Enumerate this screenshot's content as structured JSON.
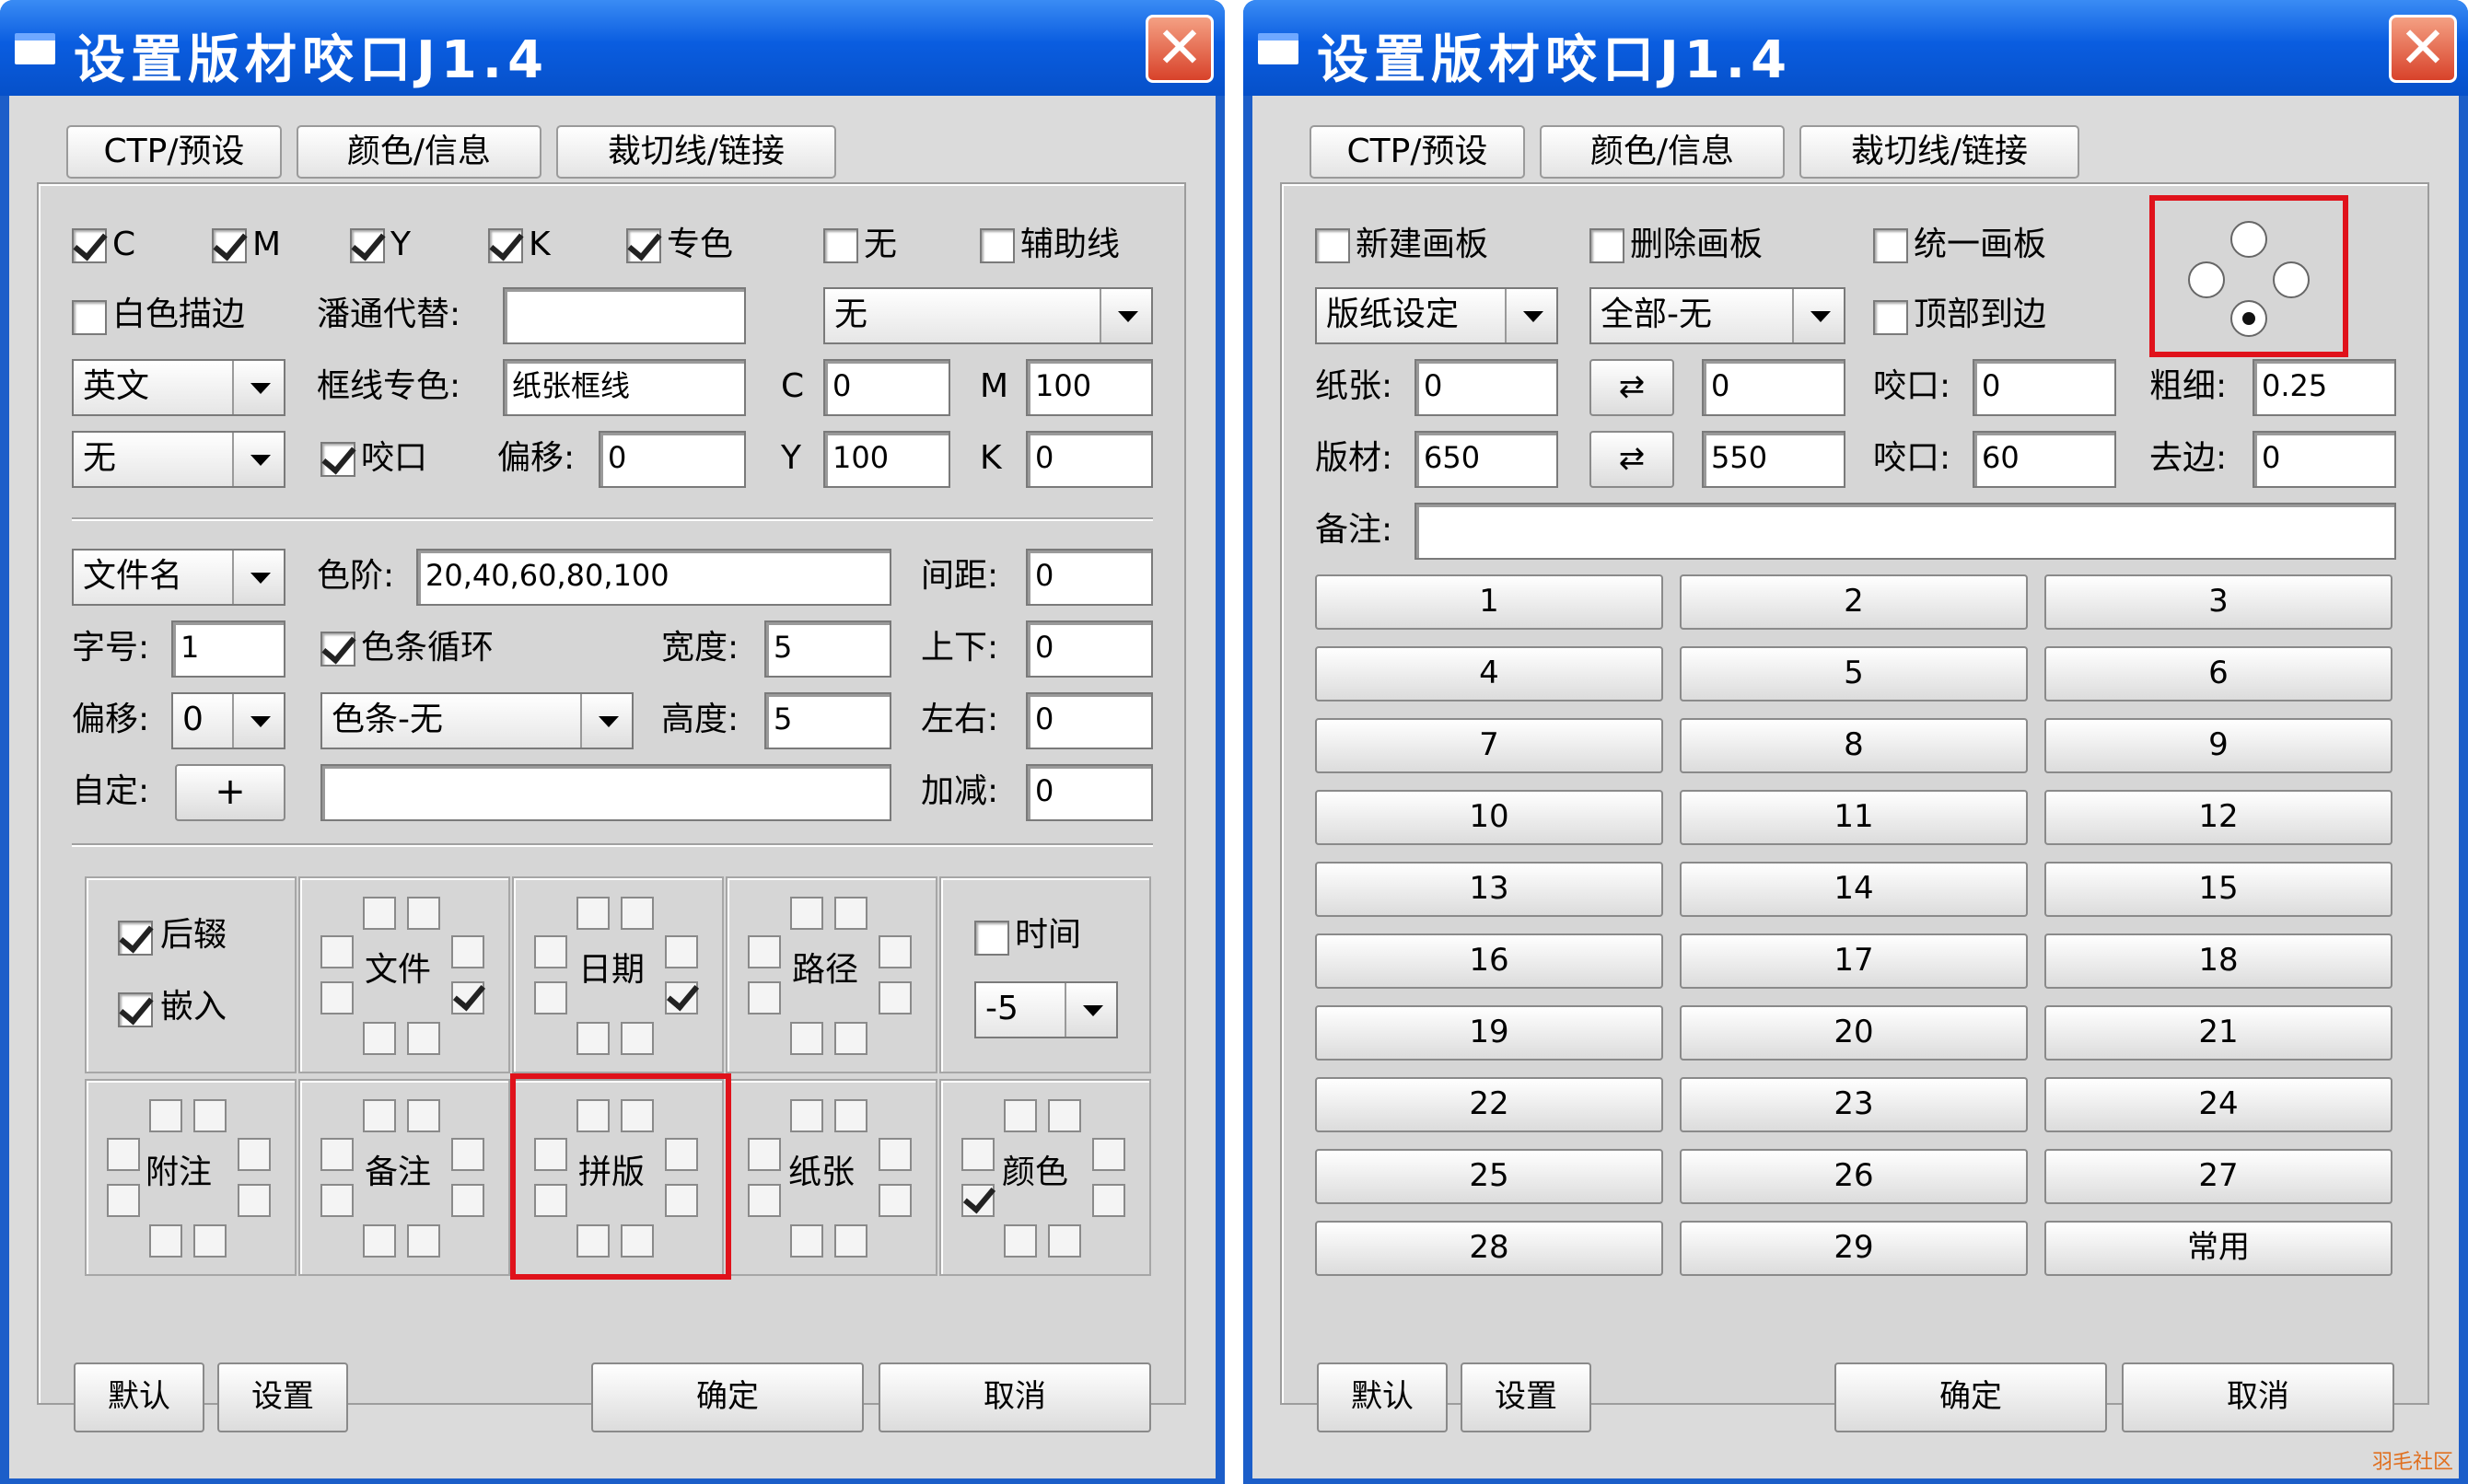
{
  "windows": [
    {
      "title": "设置版材咬口J1.4",
      "close": "✕",
      "tabs": [
        "CTP/预设",
        "颜色/信息",
        "裁切线/链接"
      ],
      "color_checks": [
        {
          "label": "C",
          "checked": true
        },
        {
          "label": "M",
          "checked": true
        },
        {
          "label": "Y",
          "checked": true
        },
        {
          "label": "K",
          "checked": true
        },
        {
          "label": "专色",
          "checked": true
        },
        {
          "label": "无",
          "checked": false
        },
        {
          "label": "辅助线",
          "checked": false
        }
      ],
      "white_outline": "白色描边",
      "pantone_sub_label": "潘通代替:",
      "pantone_sub_value": "",
      "select_none": "无",
      "lang_select": "英文",
      "frame_spot_label": "框线专色:",
      "frame_spot_value": "纸张框线",
      "c_label": "C",
      "c_value": "0",
      "m_label": "M",
      "m_value": "100",
      "none_select": "无",
      "bite_label": "咬口",
      "offset_label": "偏移:",
      "offset_value": "0",
      "y_label": "Y",
      "y_value": "100",
      "k_label": "K",
      "k_value": "0",
      "filename_select": "文件名",
      "steps_label": "色阶:",
      "steps_value": "20,40,60,80,100",
      "spacing_label": "间距:",
      "spacing_value": "0",
      "fontsize_label": "字号:",
      "fontsize_value": "1",
      "colorbar_loop": "色条循环",
      "width_label": "宽度:",
      "width_value": "5",
      "updown_label": "上下:",
      "updown_value": "0",
      "offset2_label": "偏移:",
      "offset2_value": "0",
      "colorbar_select": "色条-无",
      "height_label": "高度:",
      "height_value": "5",
      "leftright_label": "左右:",
      "leftright_value": "0",
      "custom_label": "自定:",
      "custom_btn": "+",
      "custom_value": "",
      "plusminus_label": "加减:",
      "plusminus_value": "0",
      "suffix": "后辍",
      "embed": "嵌入",
      "cells_row1": [
        "文件",
        "日期",
        "路径"
      ],
      "time_label": "时间",
      "time_value": "-5",
      "cells_row2": [
        "附注",
        "备注",
        "拼版",
        "纸张",
        "颜色"
      ],
      "btn_default": "默认",
      "btn_settings": "设置",
      "btn_ok": "确定",
      "btn_cancel": "取消"
    },
    {
      "title": "设置版材咬口J1.4",
      "close": "✕",
      "tabs": [
        "CTP/预设",
        "颜色/信息",
        "裁切线/链接"
      ],
      "new_board": "新建画板",
      "delete_board": "删除画板",
      "unify_board": "统一画板",
      "paper_select": "版纸设定",
      "all_select": "全部-无",
      "top_edge": "顶部到边",
      "paper_label": "纸张:",
      "paper_w": "0",
      "swap": "⇄",
      "paper_h": "0",
      "bite1_label": "咬口:",
      "bite1_value": "0",
      "thick_label": "粗细:",
      "thick_value": "0.25",
      "plate_label": "版材:",
      "plate_w": "650",
      "plate_h": "550",
      "bite2_label": "咬口:",
      "bite2_value": "60",
      "trim_label": "去边:",
      "trim_value": "0",
      "note_label": "备注:",
      "note_value": "",
      "presets": [
        "1",
        "2",
        "3",
        "4",
        "5",
        "6",
        "7",
        "8",
        "9",
        "10",
        "11",
        "12",
        "13",
        "14",
        "15",
        "16",
        "17",
        "18",
        "19",
        "20",
        "21",
        "22",
        "23",
        "24",
        "25",
        "26",
        "27",
        "28",
        "29",
        "常用"
      ],
      "btn_default": "默认",
      "btn_settings": "设置",
      "btn_ok": "确定",
      "btn_cancel": "取消",
      "watermark": "羽毛社区"
    }
  ],
  "colors": {
    "titlebar": "#0a5de0",
    "highlight": "#e0121b",
    "face": "#dbdbdb"
  }
}
